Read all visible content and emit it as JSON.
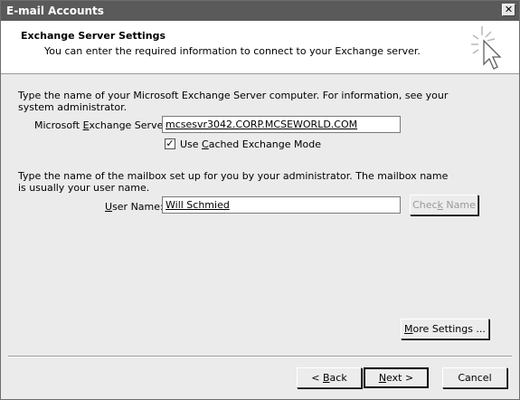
{
  "window": {
    "title": "E-mail Accounts",
    "close_glyph": "✕"
  },
  "header": {
    "title": "Exchange Server Settings",
    "subtitle": "You can enter the required information to connect to your Exchange server.",
    "icon": "wizard-cursor-icon"
  },
  "server_section": {
    "instruction_line1": "Type the name of your Microsoft Exchange Server computer. For information, see your",
    "instruction_line2": "system administrator.",
    "label_pre": "Microsoft ",
    "label_accel": "E",
    "label_post": "xchange Server:",
    "value": "mcsesvr3042.CORP.MCSEWORLD.COM",
    "cached_mode": {
      "checked": true,
      "check_glyph": "✓",
      "label_pre": "Use ",
      "label_accel": "C",
      "label_post": "ached Exchange Mode"
    }
  },
  "mailbox_section": {
    "instruction_line1": "Type the name of the mailbox set up for you by your administrator. The mailbox name",
    "instruction_line2": "is usually your user name.",
    "label_accel": "U",
    "label_post": "ser Name:",
    "value": "Will Schmied",
    "check_name_pre": "Chec",
    "check_name_accel": "k",
    "check_name_post": " Name"
  },
  "buttons": {
    "more_settings_pre": "",
    "more_settings_accel": "M",
    "more_settings_post": "ore Settings ...",
    "back_pre": "< ",
    "back_accel": "B",
    "back_post": "ack",
    "next_accel": "N",
    "next_post": "ext >",
    "cancel": "Cancel"
  },
  "colors": {
    "titlebar": "#5a5a5a",
    "dialog_bg": "#ebebeb",
    "header_bg": "#ffffff"
  }
}
